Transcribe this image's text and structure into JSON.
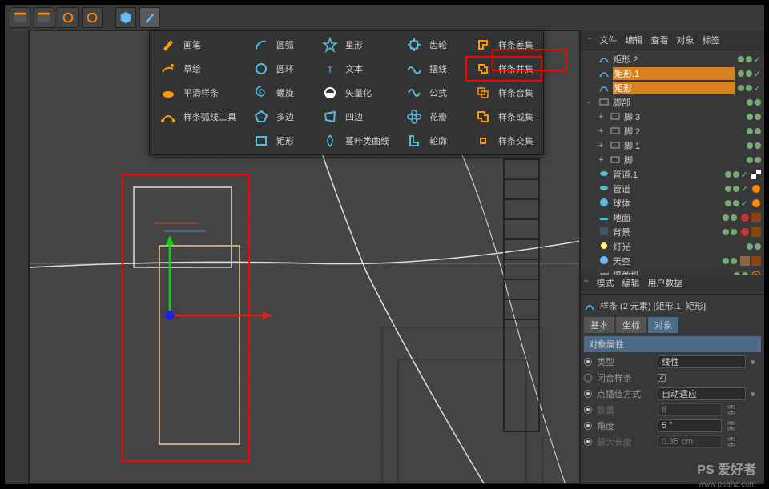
{
  "toolbar": {
    "icons": [
      "clapper1",
      "clapper2",
      "gear1",
      "gear2",
      "cube",
      "pen",
      "tube",
      "rev",
      "bool",
      "def",
      "floor",
      "light",
      "cam"
    ]
  },
  "menu": {
    "cols": [
      [
        {
          "icon": "pen-orange",
          "label": "画笔"
        },
        {
          "icon": "sketch-orange",
          "label": "草绘"
        },
        {
          "icon": "smooth-orange",
          "label": "平滑样条"
        },
        {
          "icon": "bezier-orange",
          "label": "样条弧线工具"
        }
      ],
      [
        {
          "icon": "arc-blue",
          "label": "圆弧"
        },
        {
          "icon": "circle-blue",
          "label": "圆环"
        },
        {
          "icon": "spiral-blue",
          "label": "螺旋"
        },
        {
          "icon": "nside-blue",
          "label": "多边"
        },
        {
          "icon": "rect-blue",
          "label": "矩形"
        }
      ],
      [
        {
          "icon": "star-blue",
          "label": "星形"
        },
        {
          "icon": "text-blue",
          "label": "文本"
        },
        {
          "icon": "vector-blue",
          "label": "矢量化"
        },
        {
          "icon": "4side-blue",
          "label": "四边"
        },
        {
          "icon": "cissoid-blue",
          "label": "蔓叶类曲线"
        }
      ],
      [
        {
          "icon": "gear-blue",
          "label": "齿轮"
        },
        {
          "icon": "cycloid-blue",
          "label": "摆线"
        },
        {
          "icon": "formula-blue",
          "label": "公式"
        },
        {
          "icon": "flower-blue",
          "label": "花瓣"
        },
        {
          "icon": "profile-blue",
          "label": "轮廓"
        }
      ],
      [
        {
          "icon": "diff-orange",
          "label": "样条差集"
        },
        {
          "icon": "union-orange",
          "label": "样条并集",
          "hl": true
        },
        {
          "icon": "merge-orange",
          "label": "样条合集"
        },
        {
          "icon": "or-orange",
          "label": "样条或集"
        },
        {
          "icon": "inter-orange",
          "label": "样条交集"
        }
      ]
    ]
  },
  "tree": {
    "menu": [
      "文件",
      "编辑",
      "查看",
      "对象",
      "标签"
    ],
    "items": [
      {
        "ind": 0,
        "icon": "spline",
        "name": "矩形.2",
        "color": "#5bf"
      },
      {
        "ind": 0,
        "icon": "spline",
        "name": "矩形.1",
        "color": "#f80",
        "sel": true
      },
      {
        "ind": 0,
        "icon": "spline",
        "name": "矩形",
        "color": "#f80",
        "sel": true
      },
      {
        "ind": 0,
        "icon": "null",
        "name": "脚部",
        "exp": "-"
      },
      {
        "ind": 1,
        "icon": "null",
        "name": "脚.3",
        "exp": "+"
      },
      {
        "ind": 1,
        "icon": "null",
        "name": "脚.2",
        "exp": "+"
      },
      {
        "ind": 1,
        "icon": "null",
        "name": "脚.1",
        "exp": "+"
      },
      {
        "ind": 1,
        "icon": "null",
        "name": "脚",
        "exp": "+"
      },
      {
        "ind": 0,
        "icon": "tube",
        "name": "管道.1",
        "tags": [
          "tex-check"
        ]
      },
      {
        "ind": 0,
        "icon": "tube",
        "name": "管道",
        "tags": [
          "tex-orange"
        ]
      },
      {
        "ind": 0,
        "icon": "sphere",
        "name": "球体",
        "tags": [
          "tex-orange"
        ]
      },
      {
        "ind": 0,
        "icon": "floor",
        "name": "地面",
        "tags": [
          "tex-red",
          "comp"
        ]
      },
      {
        "ind": 0,
        "icon": "bg",
        "name": "背景",
        "tags": [
          "tex-red",
          "comp"
        ]
      },
      {
        "ind": 0,
        "icon": "light",
        "name": "灯光"
      },
      {
        "ind": 0,
        "icon": "sky",
        "name": "天空",
        "tags": [
          "tex-img",
          "comp"
        ]
      },
      {
        "ind": 0,
        "icon": "camera",
        "name": "摄像机",
        "tags": [
          "target"
        ]
      }
    ]
  },
  "attr": {
    "menu": [
      "模式",
      "编辑",
      "用户数据"
    ],
    "title": "样条 (2 元素) [矩形.1, 矩形]",
    "tabs": [
      "基本",
      "坐标",
      "对象"
    ],
    "section": "对象属性",
    "rows": [
      {
        "type": "select",
        "label": "类型",
        "value": "线性"
      },
      {
        "type": "check",
        "label": "闭合样条",
        "checked": true
      },
      {
        "type": "select",
        "label": "点插值方式",
        "value": "自动适应"
      },
      {
        "type": "num",
        "label": "数量",
        "value": "8",
        "dim": true
      },
      {
        "type": "num",
        "label": "角度",
        "value": "5 °"
      },
      {
        "type": "num",
        "label": "最大长度",
        "value": "0.35 cm",
        "dim": true
      }
    ]
  },
  "watermark": {
    "big": "PS 爱好者",
    "small": "www.psahz.com"
  }
}
